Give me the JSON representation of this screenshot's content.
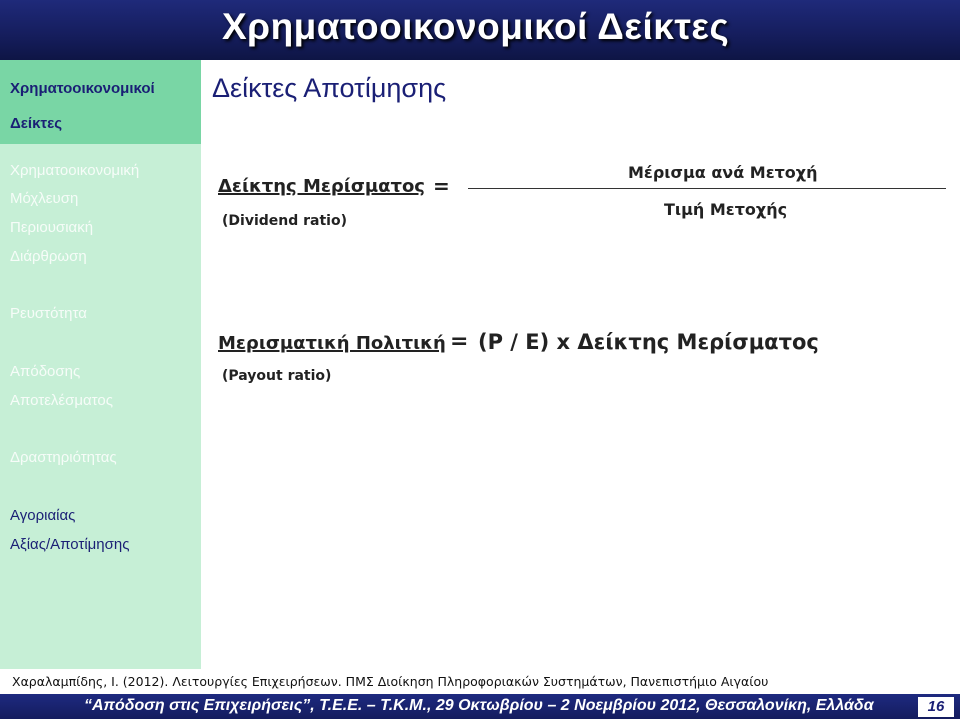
{
  "header": {
    "title": "Χρηματοοικονομικοί Δείκτες"
  },
  "sidebar": {
    "items": [
      {
        "label": "Χρηματοοικονομικοί",
        "state": "active"
      },
      {
        "label": "Δείκτες",
        "state": "active"
      },
      {
        "label": "Χρηματοοικονομική",
        "state": "faded"
      },
      {
        "label": "Μόχλευση",
        "state": "faded"
      },
      {
        "label": "Περιουσιακή",
        "state": "faded"
      },
      {
        "label": "Διάρθρωση",
        "state": "faded"
      },
      {
        "label": "Ρευστότητα",
        "state": "faded"
      },
      {
        "label": "Απόδοσης",
        "state": "faded"
      },
      {
        "label": "Αποτελέσματος",
        "state": "faded"
      },
      {
        "label": "Δραστηριότητας",
        "state": "faded"
      },
      {
        "label": "Αγοριαίας",
        "state": "normal"
      },
      {
        "label": "Αξίας/Αποτίμησης",
        "state": "normal"
      }
    ]
  },
  "main": {
    "section_title": "Δείκτες Αποτίμησης",
    "formula1": {
      "label": "Δείκτης Μερίσματος",
      "equals": "=",
      "sub": "(Dividend ratio)",
      "numerator": "Μέρισμα ανά Μετοχή",
      "denominator": "Τιμή Μετοχής"
    },
    "formula2": {
      "label": "Μερισματική Πολιτική",
      "equals": "=",
      "expression": "(P / E) x Δείκτης Μερίσματος",
      "sub": "(Payout ratio)"
    }
  },
  "reference": "Χαραλαμπίδης, Ι. (2012). Λειτουργίες Επιχειρήσεων. ΠΜΣ Διοίκηση Πληροφοριακών Συστημάτων, Πανεπιστήμιο Αιγαίου",
  "footer": {
    "text": "“Απόδοση στις Επιχειρήσεις”, Τ.Ε.Ε. – Τ.Κ.Μ., 29 Οκτωβρίου – 2 Νοεμβρίου 2012, Θεσσαλονίκη, Ελλάδα",
    "page_number": "16"
  },
  "colors": {
    "header_bg": "#151d5c",
    "sidebar_bg": "#c6efd6",
    "sidebar_active": "#79d6a5",
    "title_text": "#1a1f75"
  }
}
